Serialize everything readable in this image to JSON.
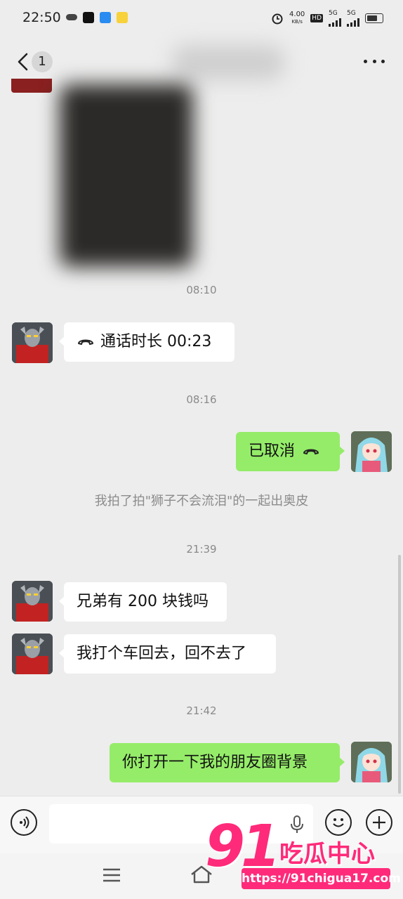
{
  "status_bar": {
    "time": "22:50",
    "speed": "4.00",
    "speed_unit": "KB/s",
    "network1": "5G",
    "network2": "5G",
    "hd": "HD"
  },
  "header": {
    "unread_count": "1"
  },
  "messages": [
    {
      "type": "time",
      "text": "08:10"
    },
    {
      "type": "call",
      "side": "left",
      "text": "通话时长 00:23"
    },
    {
      "type": "time",
      "text": "08:16"
    },
    {
      "type": "call",
      "side": "right",
      "text": "已取消"
    },
    {
      "type": "system",
      "text": "我拍了拍\"狮子不会流泪\"的一起出奥皮"
    },
    {
      "type": "time",
      "text": "21:39"
    },
    {
      "type": "text",
      "side": "left",
      "text": "兄弟有 200 块钱吗"
    },
    {
      "type": "text",
      "side": "left",
      "text": "我打个车回去，回不去了"
    },
    {
      "type": "time",
      "text": "21:42"
    },
    {
      "type": "text",
      "side": "right",
      "text": "你打开一下我的朋友圈背景"
    }
  ],
  "watermark": {
    "logo_number": "91",
    "logo_text": "吃瓜中心",
    "url": "https://91chigua17.com"
  },
  "colors": {
    "chat_bg": "#ededed",
    "bubble_self": "#95ec69",
    "bubble_other": "#ffffff",
    "watermark": "#ff2a7a"
  },
  "icons": [
    "back-arrow-icon",
    "more-icon",
    "voice-icon",
    "microphone-icon",
    "emoji-icon",
    "plus-icon",
    "menu-icon",
    "home-icon",
    "phone-hangup-icon"
  ]
}
